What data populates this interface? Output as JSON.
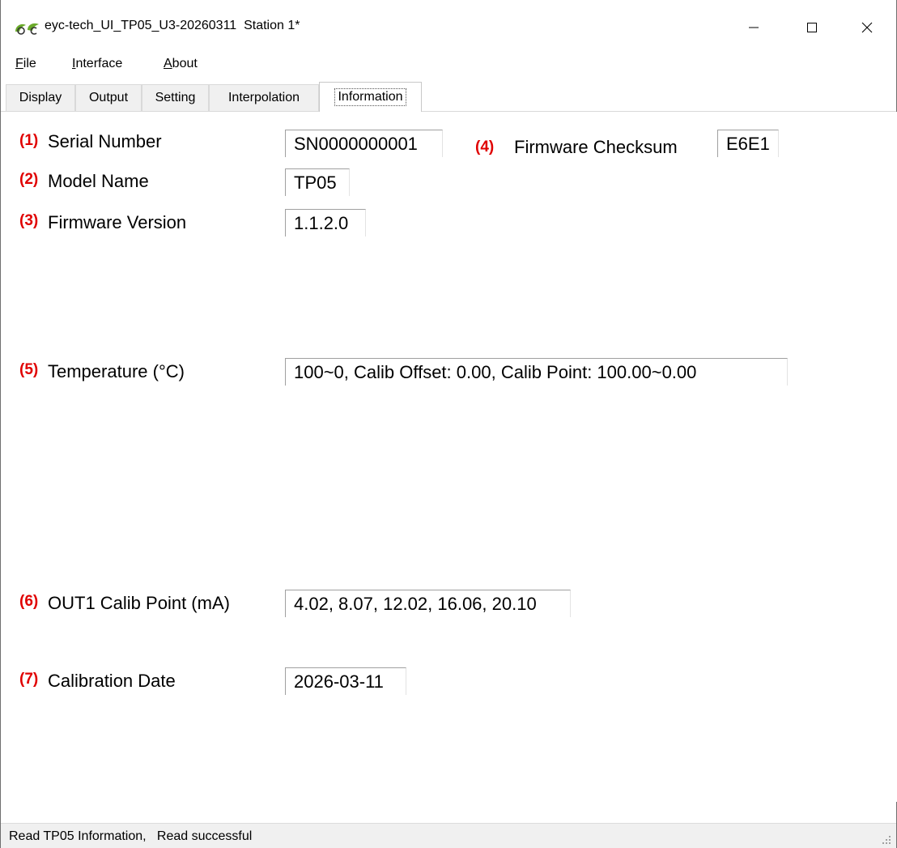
{
  "window": {
    "title": "eyc-tech_UI_TP05_U3-20260311  Station 1*",
    "logo_icon": "eyc-leaf-logo-icon",
    "controls": {
      "minimize_icon": "minimize-icon",
      "maximize_icon": "maximize-icon",
      "close_icon": "close-icon"
    }
  },
  "menu": {
    "items": [
      {
        "label": "File",
        "mnemonic": "F",
        "rest": "ile"
      },
      {
        "label": "Interface",
        "mnemonic": "I",
        "rest": "nterface"
      },
      {
        "label": "About",
        "mnemonic": "A",
        "rest": "bout"
      }
    ]
  },
  "tabs": [
    {
      "label": "Display",
      "active": false
    },
    {
      "label": "Output",
      "active": false
    },
    {
      "label": "Setting",
      "active": false
    },
    {
      "label": "Interpolation",
      "active": false
    },
    {
      "label": "Information",
      "active": true
    }
  ],
  "info": {
    "serial": {
      "num": "(1)",
      "label": "Serial Number",
      "value": "SN0000000001"
    },
    "model": {
      "num": "(2)",
      "label": "Model Name",
      "value": "TP05"
    },
    "fw_version": {
      "num": "(3)",
      "label": "Firmware Version",
      "value": "1.1.2.0"
    },
    "checksum": {
      "num": "(4)",
      "label": "Firmware Checksum",
      "value": "E6E1"
    },
    "temperature": {
      "num": "(5)",
      "label": "Temperature (°C)",
      "value": "100~0, Calib Offset: 0.00, Calib Point: 100.00~0.00"
    },
    "out1": {
      "num": "(6)",
      "label": "OUT1 Calib Point (mA)",
      "value": "4.02, 8.07, 12.02, 16.06, 20.10"
    },
    "calib_date": {
      "num": "(7)",
      "label": "Calibration Date",
      "value": "2026-03-11"
    }
  },
  "status": {
    "text": "Read TP05 Information,   Read successful",
    "grip_icon": "resize-grip-icon"
  },
  "colors": {
    "annotation": "#e00000",
    "logo_green": "#6aaa2a"
  }
}
